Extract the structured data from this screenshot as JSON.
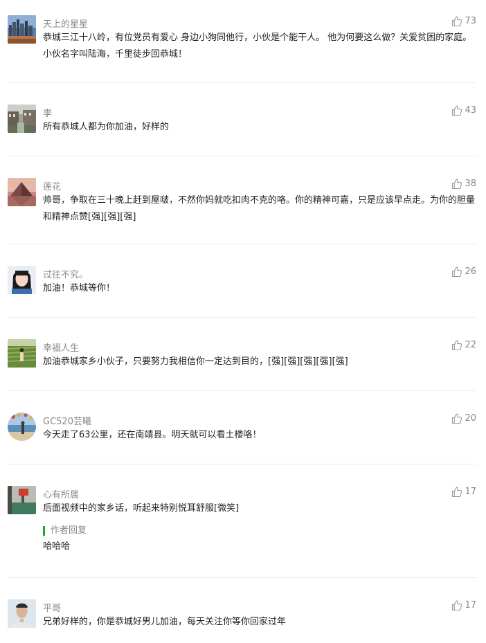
{
  "comments": [
    {
      "name": "天上的星星",
      "likes": "73",
      "text": "恭城三江十八岭，有位党员有爱心 身边小狗同他行，小伙是个能干人。 他为何要这么做？关爱贫困的家庭。 小伙名字叫陆海，千里徒步回恭城！"
    },
    {
      "name": "李",
      "likes": "43",
      "text": "所有恭城人都为你加油，好样的"
    },
    {
      "name": "莲花",
      "likes": "38",
      "text": "帅哥，争取在三十晚上赶到屋啵，不然你妈就吃扣肉不克的咯。你的精神可嘉，只是应该早点走。为你的胆量和精神点赞[强][强][强]"
    },
    {
      "name": "过往不究。",
      "likes": "26",
      "text": "加油！恭城等你！"
    },
    {
      "name": "幸福人生",
      "likes": "22",
      "text": "加油恭城家乡小伙子，只要努力我相信你一定达到目的，[强][强][强][强][强]"
    },
    {
      "name": "GC520芸曦",
      "likes": "20",
      "text": "今天走了63公里，还在南靖县。明天就可以看土楼咯！"
    },
    {
      "name": "心有所属",
      "likes": "17",
      "text": "后面视频中的家乡话，听起来特别悦耳舒服[微笑]",
      "reply_label": "作者回复",
      "reply_text": "哈哈哈"
    },
    {
      "name": "平哥",
      "likes": "17",
      "text": "兄弟好样的，你是恭城好男儿加油，每天关注你等你回家过年"
    }
  ],
  "icons": {
    "like": "thumbs-up-icon"
  },
  "colors": {
    "meta": "#888888",
    "reply_accent": "#1aad19",
    "divider": "#ececec"
  }
}
